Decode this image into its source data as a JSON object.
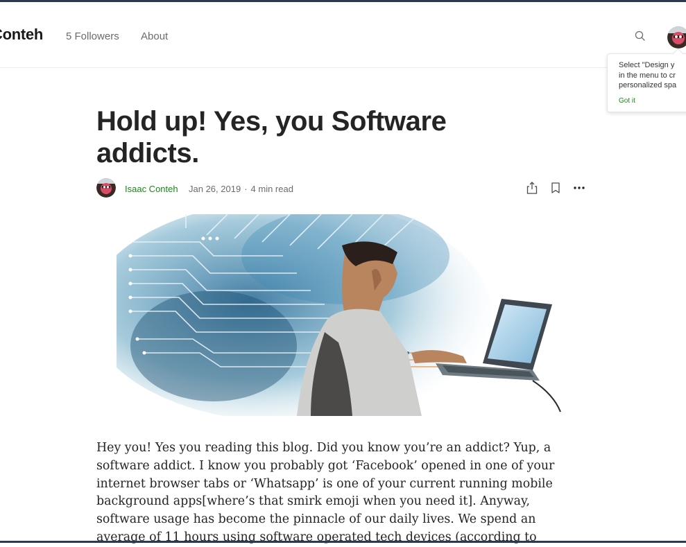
{
  "header": {
    "brand": "Conteh",
    "followers": "5 Followers",
    "about": "About"
  },
  "tooltip": {
    "lines": [
      "Select \"Design y",
      "in the menu to cr",
      "personalized spa"
    ],
    "action": "Got it"
  },
  "article": {
    "title_lines": [
      "Hold up! Yes, you Software",
      "addicts."
    ],
    "author": "Isaac Conteh",
    "date": "Jan 26, 2019",
    "separator": "·",
    "read_time": "4 min read",
    "body_lines": [
      "Hey you! Yes you reading this blog. Did you know you’re an addict? Yup, a",
      "software addict. I know you probably got ‘Facebook’ opened in one of your",
      "internet browser tabs or ‘Whatsapp’ is one of your current running mobile",
      "background apps[where’s that smirk emoji when you need it]. Anyway,",
      "software usage has become the pinnacle of our daily lives. We spend an",
      "average of 11 hours using software operated tech devices (according to"
    ]
  },
  "icons": {
    "search": "search-icon",
    "share": "share-icon",
    "bookmark": "bookmark-icon",
    "more": "more-icon"
  },
  "colors": {
    "accent_green": "#1a8917",
    "text_primary": "#242424",
    "text_muted": "#6b6b6b",
    "frame": "#2b3a4e"
  }
}
